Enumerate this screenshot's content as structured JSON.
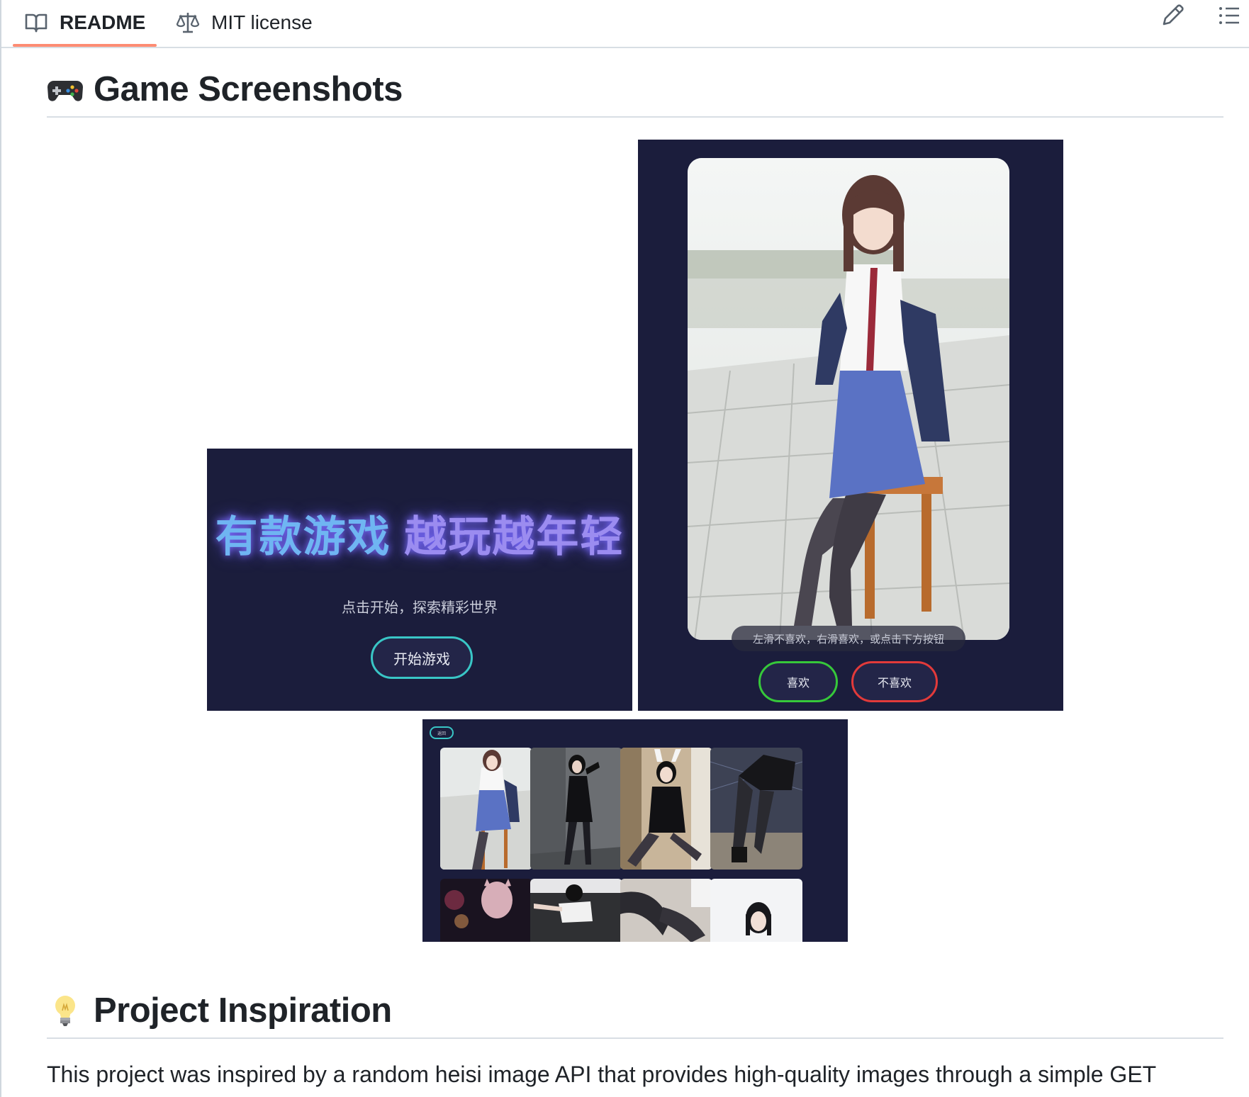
{
  "tabs": {
    "readme": {
      "label": "README",
      "icon": "book-icon"
    },
    "license": {
      "label": "MIT license",
      "icon": "scale-icon"
    }
  },
  "toolbar": {
    "edit_icon": "pencil-icon",
    "toc_icon": "list-icon"
  },
  "sections": {
    "screenshots": {
      "emoji": "game-controller-icon",
      "title": "Game Screenshots"
    },
    "inspiration": {
      "emoji": "lightbulb-icon",
      "title": "Project Inspiration",
      "text": "This project was inspired by a random heisi image API that provides high-quality images through a simple GET"
    }
  },
  "start_screen": {
    "title_part1": "有款游戏",
    "title_part2": "越玩越年轻",
    "subtitle": "点击开始，探索精彩世界",
    "start_button": "开始游戏"
  },
  "swipe_screen": {
    "hint": "左滑不喜欢，右滑喜欢，或点击下方按钮",
    "like_button": "喜欢",
    "dislike_button": "不喜欢"
  },
  "gallery_screen": {
    "back_button": "返回",
    "thumbnails": 8
  },
  "colors": {
    "tab_underline": "#fd8c73",
    "app_background": "#1b1d3c",
    "teal": "#39c6c6",
    "like_green": "#36c83a",
    "dislike_red": "#e23a3a"
  }
}
